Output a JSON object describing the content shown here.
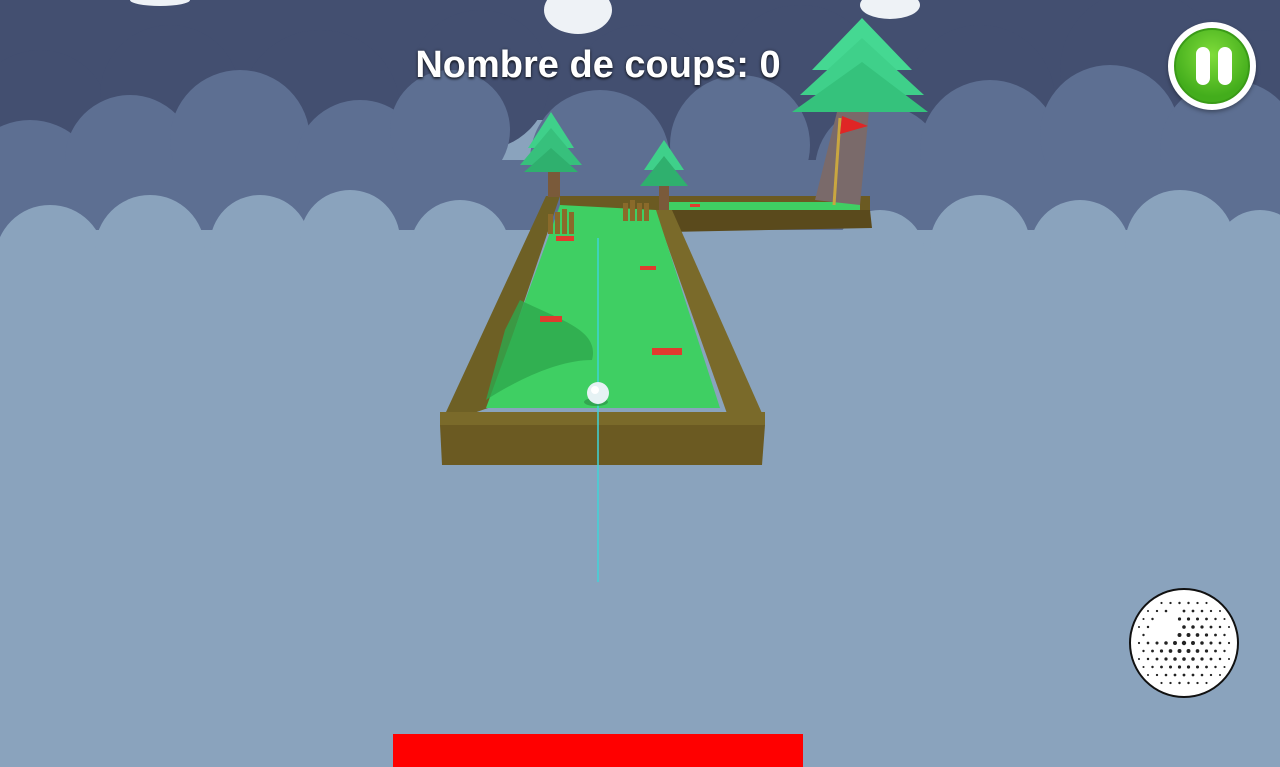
{
  "hud": {
    "title": "Nombre de coups: 0",
    "stroke_count": 0
  },
  "controls": {
    "pause_icon": "pause-icon",
    "shoot_icon": "golf-ball-icon",
    "power_level": 1.0
  },
  "colors": {
    "sky": "#8aa3bd",
    "grass": "#3fcf63",
    "wall": "#6b5a22",
    "power_bar": "#ff0000",
    "pause_button": "#4bb320",
    "flag": "#e02525"
  }
}
